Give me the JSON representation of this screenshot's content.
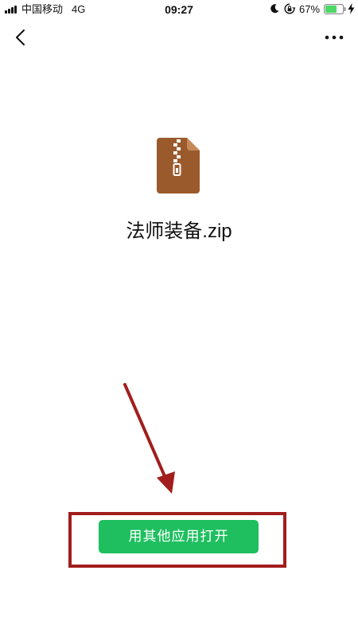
{
  "status_bar": {
    "carrier": "中国移动",
    "network": "4G",
    "time": "09:27",
    "battery_percent": "67%",
    "battery_level": 0.67,
    "battery_color": "#4cd964"
  },
  "nav": {
    "back_icon": "chevron-left-icon",
    "more_icon": "more-horizontal-icon"
  },
  "file": {
    "name": "法师装备.zip",
    "icon": "zip-archive-icon",
    "icon_color": "#9b5a2c"
  },
  "actions": {
    "open_with_label": "用其他应用打开",
    "button_color": "#1fbf5f"
  },
  "annotation": {
    "color": "#a21d1d"
  }
}
